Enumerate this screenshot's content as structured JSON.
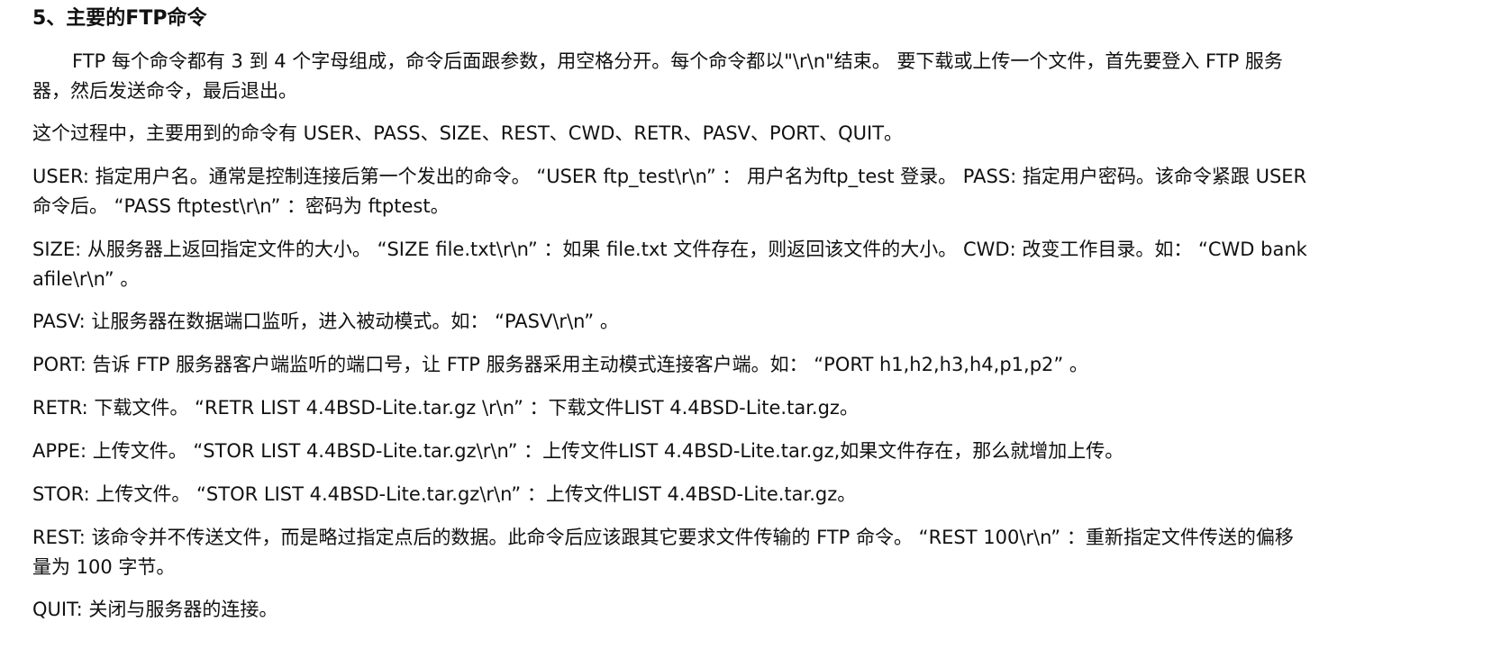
{
  "document": {
    "heading": "5、主要的FTP命令",
    "paragraphs": [
      "FTP 每个命令都有 3 到 4 个字母组成，命令后面跟参数，用空格分开。每个命令都以\"\\r\\n\"结束。 要下载或上传一个文件，首先要登入 FTP 服务器，然后发送命令，最后退出。",
      "这个过程中，主要用到的命令有 USER、PASS、SIZE、REST、CWD、RETR、PASV、PORT、QUIT。",
      "USER: 指定用户名。通常是控制连接后第一个发出的命令。 “USER ftp_test\\r\\n” ： 用户名为ftp_test 登录。 PASS: 指定用户密码。该命令紧跟 USER 命令后。 “PASS ftptest\\r\\n” ：密码为 ftptest。",
      "SIZE: 从服务器上返回指定文件的大小。 “SIZE file.txt\\r\\n” ：如果 file.txt 文件存在，则返回该文件的大小。 CWD: 改变工作目录。如： “CWD bankafile\\r\\n” 。",
      "PASV: 让服务器在数据端口监听，进入被动模式。如： “PASV\\r\\n” 。",
      "PORT: 告诉 FTP 服务器客户端监听的端口号，让 FTP 服务器采用主动模式连接客户端。如： “PORT h1,h2,h3,h4,p1,p2” 。",
      "RETR: 下载文件。 “RETR LIST 4.4BSD-Lite.tar.gz \\r\\n” ：下载文件LIST 4.4BSD-Lite.tar.gz。",
      "APPE: 上传文件。 “STOR LIST 4.4BSD-Lite.tar.gz\\r\\n” ：上传文件LIST 4.4BSD-Lite.tar.gz,如果文件存在，那么就增加上传。",
      "STOR: 上传文件。 “STOR LIST 4.4BSD-Lite.tar.gz\\r\\n” ：上传文件LIST 4.4BSD-Lite.tar.gz。",
      "REST: 该命令并不传送文件，而是略过指定点后的数据。此命令后应该跟其它要求文件传输的 FTP 命令。 “REST 100\\r\\n” ：重新指定文件传送的偏移量为 100 字节。",
      "QUIT: 关闭与服务器的连接。"
    ]
  }
}
